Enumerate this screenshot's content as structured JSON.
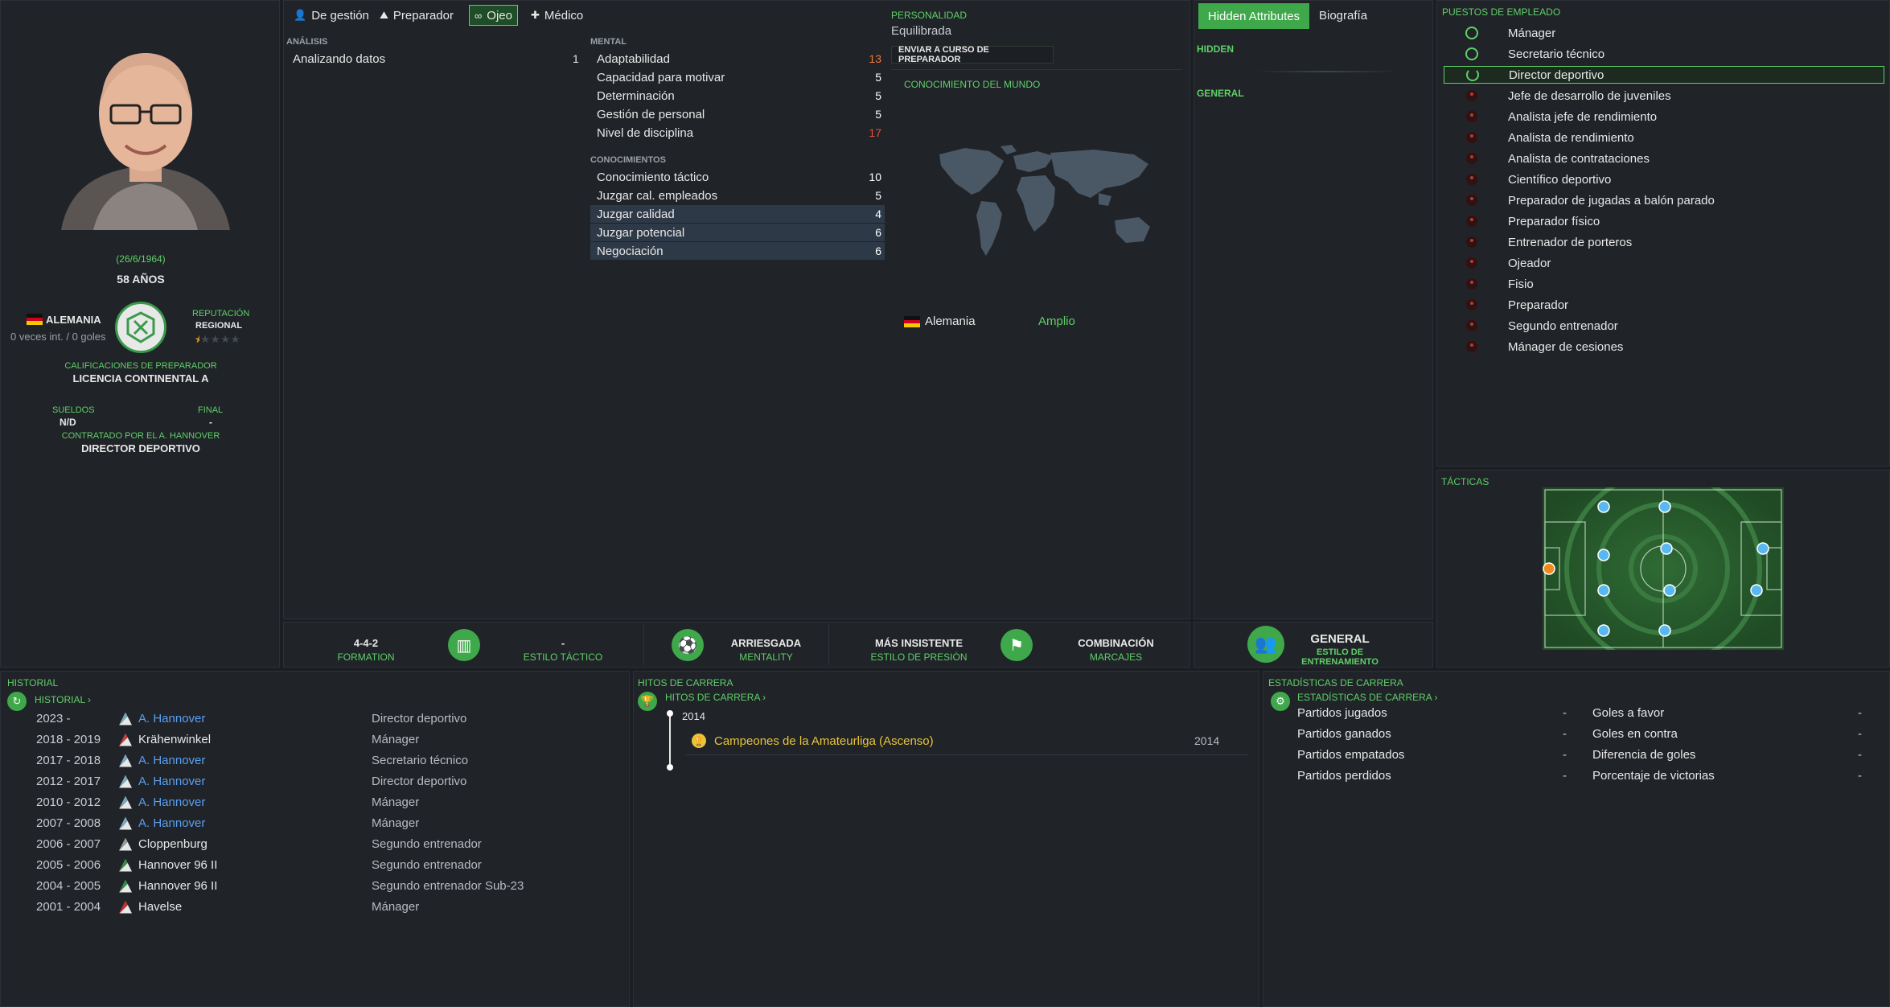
{
  "profile": {
    "birthdate": "(26/6/1964)",
    "age": "58 AÑOS",
    "nation": "ALEMANIA",
    "caps": "0 veces int. / 0 goles",
    "reputation_label": "REPUTACIÓN",
    "reputation_value": "REGIONAL",
    "reputation_stars": 0.5,
    "coach_badges_label": "CALIFICACIONES DE PREPARADOR",
    "coach_badges_value": "LICENCIA CONTINENTAL A",
    "wages_label": "SUELDOS",
    "wages_value": "N/D",
    "end_label": "FINAL",
    "end_value": "-",
    "contracted_label": "CONTRATADO POR EL A. HANNOVER",
    "contracted_role": "DIRECTOR DEPORTIVO"
  },
  "tabs": [
    {
      "label": "De gestión",
      "icon": "person-icon"
    },
    {
      "label": "Preparador",
      "icon": "coach-icon"
    },
    {
      "label": "Ojeo",
      "icon": "binoculars-icon",
      "active": true
    },
    {
      "label": "Médico",
      "icon": "medical-kit-icon"
    }
  ],
  "analysis": {
    "header": "ANÁLISIS",
    "label": "Analizando datos",
    "value": "1"
  },
  "mental": {
    "header": "MENTAL",
    "rows": [
      {
        "label": "Adaptabilidad",
        "value": "13",
        "color": "#f07a3a"
      },
      {
        "label": "Capacidad para motivar",
        "value": "5",
        "color": "#ffffff"
      },
      {
        "label": "Determinación",
        "value": "5",
        "color": "#ffffff"
      },
      {
        "label": "Gestión de personal",
        "value": "5",
        "color": "#ffffff"
      },
      {
        "label": "Nivel de disciplina",
        "value": "17",
        "color": "#e8503a"
      }
    ]
  },
  "knowledge": {
    "header": "CONOCIMIENTOS",
    "rows": [
      {
        "label": "Conocimiento táctico",
        "value": "10"
      },
      {
        "label": "Juzgar cal. empleados",
        "value": "5"
      },
      {
        "label": "Juzgar calidad",
        "value": "4"
      },
      {
        "label": "Juzgar potencial",
        "value": "6"
      },
      {
        "label": "Negociación",
        "value": "6"
      }
    ]
  },
  "personality": {
    "label": "PERSONALIDAD",
    "value": "Equilibrada",
    "course_button": "ENVIAR A CURSO DE PREPARADOR"
  },
  "world": {
    "header": "CONOCIMIENTO DEL MUNDO",
    "country": "Alemania",
    "level": "Amplio"
  },
  "tactics_bar": {
    "formation_value": "4-4-2",
    "formation_label": "FORMATION",
    "style_value": "-",
    "style_label": "ESTILO TÁCTICO",
    "mentality_value": "ARRIESGADA",
    "mentality_label": "MENTALITY",
    "pressing_value": "MÁS INSISTENTE",
    "pressing_label": "ESTILO DE PRESIÓN",
    "marking_value": "COMBINACIÓN",
    "marking_label": "MARCAJES",
    "training_value": "GENERAL",
    "training_label": "ESTILO DE ENTRENAMIENTO"
  },
  "hidden_panel": {
    "tab_hidden": "Hidden Attributes",
    "tab_bio": "Biografía",
    "hidden_header": "HIDDEN",
    "general_header": "GENERAL"
  },
  "roles": {
    "header": "PUESTOS DE EMPLEADO",
    "items": [
      {
        "label": "Mánager",
        "state": "on"
      },
      {
        "label": "Secretario técnico",
        "state": "on"
      },
      {
        "label": "Director deportivo",
        "state": "current"
      },
      {
        "label": "Jefe de desarrollo de juveniles",
        "state": "off"
      },
      {
        "label": "Analista jefe de rendimiento",
        "state": "off"
      },
      {
        "label": "Analista de rendimiento",
        "state": "off"
      },
      {
        "label": "Analista de contrataciones",
        "state": "off"
      },
      {
        "label": "Científico deportivo",
        "state": "off"
      },
      {
        "label": "Preparador de jugadas a balón parado",
        "state": "off"
      },
      {
        "label": "Preparador físico",
        "state": "off"
      },
      {
        "label": "Entrenador de porteros",
        "state": "off"
      },
      {
        "label": "Ojeador",
        "state": "off"
      },
      {
        "label": "Fisio",
        "state": "off"
      },
      {
        "label": "Preparador",
        "state": "off"
      },
      {
        "label": "Segundo entrenador",
        "state": "off"
      },
      {
        "label": "Mánager de cesiones",
        "state": "off"
      }
    ]
  },
  "tactics": {
    "header": "TÁCTICAS"
  },
  "history": {
    "header": "HISTORIAL",
    "link": "HISTORIAL ›",
    "rows": [
      {
        "years": "2023 -",
        "club": "A. Hannover",
        "link": true,
        "role": "Director deportivo",
        "crest": "#7fa6b8"
      },
      {
        "years": "2018 - 2019",
        "club": "Krähenwinkel",
        "link": false,
        "role": "Mánager",
        "crest": "#c04040"
      },
      {
        "years": "2017 - 2018",
        "club": "A. Hannover",
        "link": true,
        "role": "Secretario técnico",
        "crest": "#7fa6b8"
      },
      {
        "years": "2012 - 2017",
        "club": "A. Hannover",
        "link": true,
        "role": "Director deportivo",
        "crest": "#7fa6b8"
      },
      {
        "years": "2010 - 2012",
        "club": "A. Hannover",
        "link": true,
        "role": "Mánager",
        "crest": "#7fa6b8"
      },
      {
        "years": "2007 - 2008",
        "club": "A. Hannover",
        "link": true,
        "role": "Mánager",
        "crest": "#7fa6b8"
      },
      {
        "years": "2006 - 2007",
        "club": "Cloppenburg",
        "link": false,
        "role": "Segundo entrenador",
        "crest": "#9a9a9a"
      },
      {
        "years": "2005 - 2006",
        "club": "Hannover 96 II",
        "link": false,
        "role": "Segundo entrenador",
        "crest": "#3a8a4a"
      },
      {
        "years": "2004 - 2005",
        "club": "Hannover 96 II",
        "link": false,
        "role": "Segundo entrenador Sub-23",
        "crest": "#3a8a4a"
      },
      {
        "years": "2001 - 2004",
        "club": "Havelse",
        "link": false,
        "role": "Mánager",
        "crest": "#c03030"
      }
    ]
  },
  "milestones": {
    "header": "HITOS DE CARRERA",
    "link": "HITOS DE CARRERA ›",
    "year": "2014",
    "item": "Campeones de la Amateurliga (Ascenso)",
    "item_year": "2014"
  },
  "career_stats": {
    "header": "ESTADÍSTICAS DE CARRERA",
    "link": "ESTADÍSTICAS DE CARRERA ›",
    "left": [
      {
        "label": "Partidos jugados",
        "value": "-"
      },
      {
        "label": "Partidos ganados",
        "value": "-"
      },
      {
        "label": "Partidos empatados",
        "value": "-"
      },
      {
        "label": "Partidos perdidos",
        "value": "-"
      }
    ],
    "right": [
      {
        "label": "Goles a favor",
        "value": "-"
      },
      {
        "label": "Goles en contra",
        "value": "-"
      },
      {
        "label": "Diferencia de goles",
        "value": "-"
      },
      {
        "label": "Porcentaje de victorias",
        "value": "-"
      }
    ]
  }
}
